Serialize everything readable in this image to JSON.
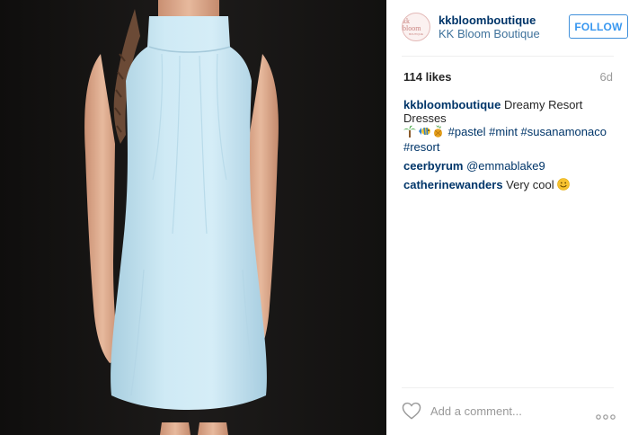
{
  "post": {
    "image_alt": "Light blue sleeveless high-neck dress on model against dark background"
  },
  "header": {
    "avatar_logo_top": "kk bloom",
    "avatar_logo_bottom": "BOUTIQUE",
    "username": "kkbloomboutique",
    "full_name": "KK Bloom Boutique",
    "follow_label": "FOLLOW"
  },
  "stats": {
    "likes": "114 likes",
    "age": "6d"
  },
  "caption": {
    "user": "kkbloomboutique",
    "text": "Dreamy Resort Dresses",
    "hashtags": "#pastel #mint #susanamonaco #resort"
  },
  "comments": [
    {
      "user": "ceerbyrum",
      "text": "@emmablake9"
    },
    {
      "user": "catherinewanders",
      "text": "Very cool"
    }
  ],
  "footer": {
    "add_comment_placeholder": "Add a comment..."
  },
  "colors": {
    "accent": "#3897f0",
    "username": "#003569",
    "muted": "#999999",
    "dress": "#c6e6f2",
    "backdrop": "#141312"
  },
  "icons": [
    "like-heart-icon",
    "more-options-icon",
    "palm-tree-emoji",
    "tropical-fish-emoji",
    "pineapple-drink-emoji",
    "smile-emoji"
  ]
}
